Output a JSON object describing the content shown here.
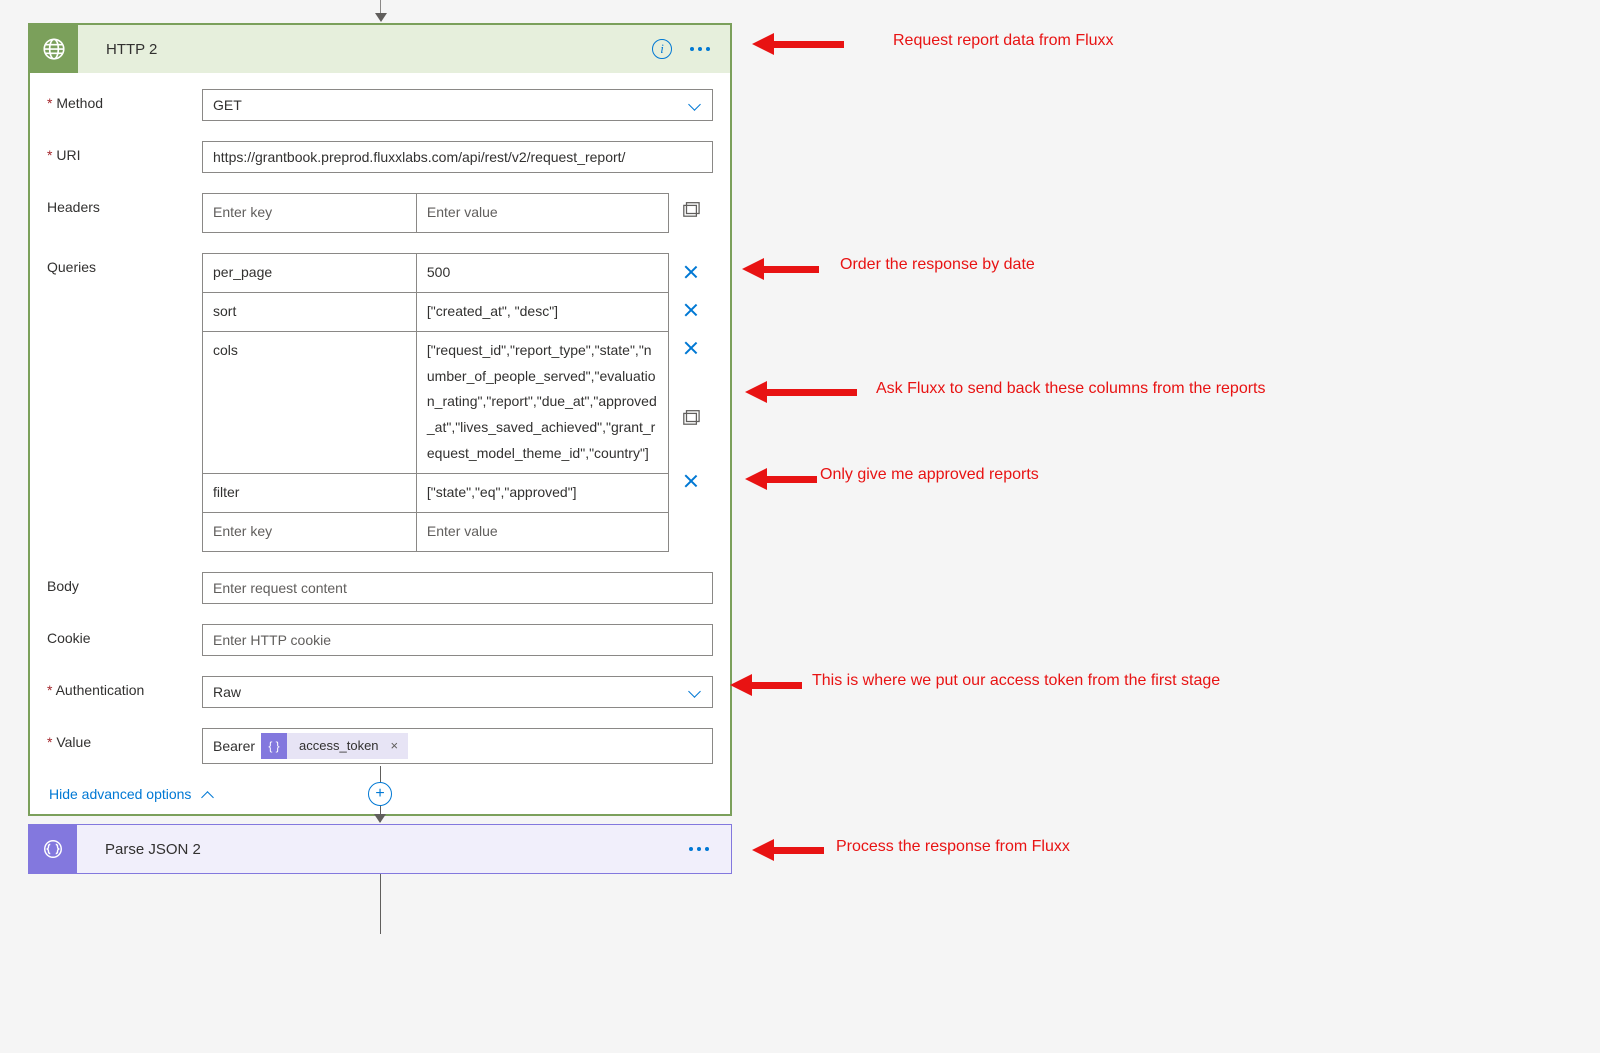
{
  "http": {
    "title": "HTTP 2",
    "method_label": "Method",
    "method_value": "GET",
    "uri_label": "URI",
    "uri_value": "https://grantbook.preprod.fluxxlabs.com/api/rest/v2/request_report/",
    "headers_label": "Headers",
    "headers_key_ph": "Enter key",
    "headers_val_ph": "Enter value",
    "queries_label": "Queries",
    "queries": [
      {
        "key": "per_page",
        "value": "500"
      },
      {
        "key": "sort",
        "value": "[\"created_at\", \"desc\"]"
      },
      {
        "key": "cols",
        "value": "[\"request_id\",\"report_type\",\"state\",\"number_of_people_served\",\"evaluation_rating\",\"report\",\"due_at\",\"approved_at\",\"lives_saved_achieved\",\"grant_request_model_theme_id\",\"country\"]"
      },
      {
        "key": "filter",
        "value": "[\"state\",\"eq\",\"approved\"]"
      }
    ],
    "queries_key_ph": "Enter key",
    "queries_val_ph": "Enter value",
    "body_label": "Body",
    "body_ph": "Enter request content",
    "cookie_label": "Cookie",
    "cookie_ph": "Enter HTTP cookie",
    "auth_label": "Authentication",
    "auth_value": "Raw",
    "value_label": "Value",
    "value_prefix": "Bearer ",
    "token_name": "access_token",
    "adv_link": "Hide advanced options"
  },
  "json": {
    "title": "Parse JSON 2"
  },
  "annotations": {
    "a1": "Request report data from Fluxx",
    "a2": "Order the response by date",
    "a3": "Ask Fluxx to send back these columns from the reports",
    "a4": "Only give me approved reports",
    "a5": "This is where we put our access token from the first stage",
    "a6": "Process the response from Fluxx"
  }
}
